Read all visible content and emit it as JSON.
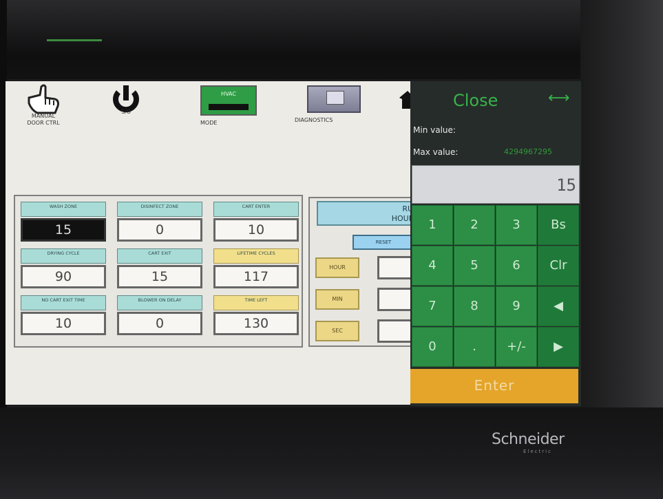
{
  "nav": {
    "manual_door_ctrl": "MANUAL\nDOOR CTRL",
    "power": "S/O",
    "mode": "MODE",
    "mode_button": "HVAC",
    "diagnostics": "DIAGNOSTICS"
  },
  "fields": [
    {
      "label": "WASH ZONE",
      "value": "15",
      "style": "dark"
    },
    {
      "label": "DISINFECT ZONE",
      "value": "0",
      "style": "teal"
    },
    {
      "label": "CART ENTER",
      "value": "10",
      "style": "teal"
    },
    {
      "label": "DRYING CYCLE",
      "value": "90",
      "style": "teal"
    },
    {
      "label": "CART EXIT",
      "value": "15",
      "style": "teal"
    },
    {
      "label": "LIFETIME CYCLES",
      "value": "117",
      "style": "yellow"
    },
    {
      "label": "NO CART EXIT TIME",
      "value": "10",
      "style": "teal"
    },
    {
      "label": "BLOWER ON DELAY",
      "value": "0",
      "style": "teal"
    },
    {
      "label": "TIME LEFT",
      "value": "130",
      "style": "yellow"
    }
  ],
  "running_hour": {
    "title_line1": "RUNNIN",
    "title_line2": "HOUR MET",
    "reset": "RESET",
    "hour": "HOUR",
    "min": "MIN",
    "sec": "SEC"
  },
  "keypad": {
    "close": "Close",
    "min_label": "Min value:",
    "max_label": "Max value:",
    "max_value": "4294967295",
    "display": "15",
    "keys": [
      "1",
      "2",
      "3",
      "Bs",
      "4",
      "5",
      "6",
      "Clr",
      "7",
      "8",
      "9",
      "◀",
      "0",
      ".",
      "+/-",
      "▶"
    ],
    "enter": "Enter"
  },
  "brand": {
    "name": "Schneider",
    "sub": "Electric"
  },
  "colors": {
    "keypad_green": "#2c8f45",
    "enter_orange": "#e4a52a",
    "teal_header": "#a9dcd7",
    "yellow_header": "#f1df8c"
  }
}
